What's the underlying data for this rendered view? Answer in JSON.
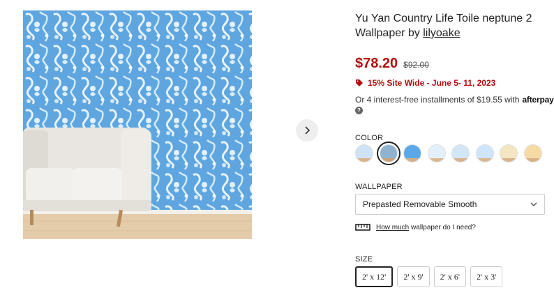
{
  "product": {
    "title": "Yu Yan Country Life Toile neptune 2 Wallpaper by",
    "designer": "lilyoake",
    "price": "$78.20",
    "original_price": "$92.00",
    "sale_text": "15% Site Wide - June 5- 11, 2023",
    "installments_text": "Or 4 interest-free installments of $19.55 with",
    "afterpay_brand": "afterpay",
    "help_mark": "?"
  },
  "color": {
    "label": "COLOR",
    "selected_index": 1,
    "swatches": [
      {
        "top": "#cfe3f4",
        "bottom": "#d9b48a"
      },
      {
        "top": "#8fb3cf",
        "bottom": "#c9a27a"
      },
      {
        "top": "#5aa8e8",
        "bottom": "#d4b08a"
      },
      {
        "top": "#e3eff9",
        "bottom": "#d9b891"
      },
      {
        "top": "#d3e6f6",
        "bottom": "#d7b48d"
      },
      {
        "top": "#cfe5fb",
        "bottom": "#d9b792"
      },
      {
        "top": "#f4e6c2",
        "bottom": "#d7b48a"
      },
      {
        "top": "#f6dca4",
        "bottom": "#d8b185"
      }
    ]
  },
  "wallpaper": {
    "label": "WALLPAPER",
    "selected": "Prepasted Removable Smooth",
    "how_much_link": "How much",
    "how_much_rest": "wallpaper do I need?"
  },
  "size": {
    "label": "SIZE",
    "options": [
      "2' x 12'",
      "2' x 9'",
      "2' x 6'",
      "2' x 3'"
    ],
    "selected_index": 0
  },
  "gallery": {
    "image_description_icon": "room-preview-image",
    "next_icon": "chevron-right-icon"
  }
}
